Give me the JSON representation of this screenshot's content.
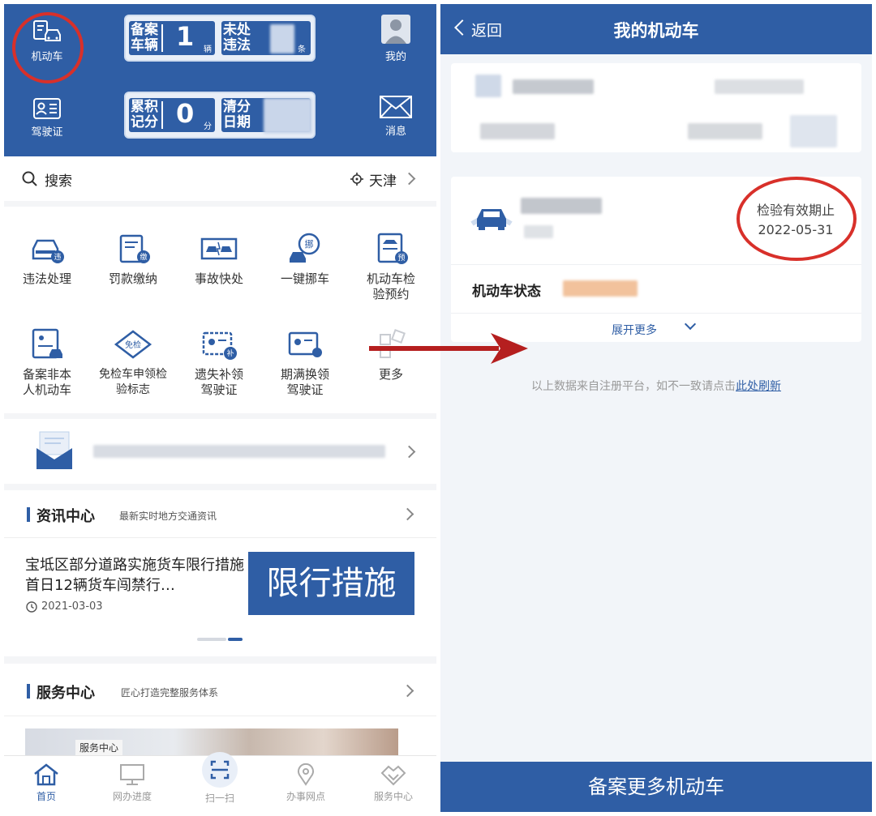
{
  "left": {
    "header": {
      "motor_label": "机动车",
      "license_label": "驾驶证",
      "mine_label": "我的",
      "message_label": "消息",
      "registered_l1": "备案",
      "registered_l2": "车辆",
      "registered_count": "1",
      "registered_unit": "辆",
      "unhandled_l1": "未处",
      "unhandled_l2": "违法",
      "unhandled_unit": "条",
      "points_l1": "累积",
      "points_l2": "记分",
      "points_value": "0",
      "points_unit": "分",
      "clear_l1": "清分",
      "clear_l2": "日期"
    },
    "search": {
      "label": "搜索",
      "city": "天津"
    },
    "services": [
      {
        "label": "违法处理",
        "icon": "car-violation-icon",
        "badge": "违"
      },
      {
        "label": "罚款缴纳",
        "icon": "fine-pay-icon",
        "badge": "缴"
      },
      {
        "label": "事故快处",
        "icon": "accident-icon"
      },
      {
        "label": "一键挪车",
        "icon": "move-car-icon",
        "badge": "挪"
      },
      {
        "label": "机动车检验预约",
        "icon": "inspection-booking-icon",
        "badge": "预"
      },
      {
        "label": "备案非本人机动车",
        "icon": "register-other-car-icon"
      },
      {
        "label": "免检车申领检验标志",
        "icon": "exempt-inspection-icon",
        "badge": "免检"
      },
      {
        "label": "遗失补领驾驶证",
        "icon": "lost-license-icon",
        "badge": "补"
      },
      {
        "label": "期满换领驾驶证",
        "icon": "renew-license-icon"
      },
      {
        "label": "更多",
        "icon": "more-icon"
      }
    ],
    "news": {
      "title": "资讯中心",
      "subtitle": "最新实时地方交通资讯",
      "headline": "宝坻区部分道路实施货车限行措施首日12辆货车闯禁行…",
      "date": "2021-03-03",
      "banner_text": "限行措施"
    },
    "service_center": {
      "title": "服务中心",
      "subtitle": "匠心打造完整服务体系",
      "photo_label": "服务中心"
    },
    "tabs": [
      {
        "label": "首页",
        "icon": "home-icon",
        "active": true
      },
      {
        "label": "网办进度",
        "icon": "monitor-icon",
        "active": false
      },
      {
        "label": "扫一扫",
        "icon": "scan-icon",
        "active": false
      },
      {
        "label": "办事网点",
        "icon": "location-pin-icon",
        "active": false
      },
      {
        "label": "服务中心",
        "icon": "handshake-icon",
        "active": false
      }
    ]
  },
  "right": {
    "back_label": "返回",
    "title": "我的机动车",
    "inspection_label": "检验有效期止",
    "inspection_date": "2022-05-31",
    "status_label": "机动车状态",
    "expand_label": "展开更多",
    "source_text": "以上数据来自注册平台，如不一致请点击",
    "refresh_link": "此处刷新",
    "bottom_button": "备案更多机动车"
  },
  "colors": {
    "brand_blue": "#2f5ea5",
    "annotation_red": "#d8302a"
  }
}
